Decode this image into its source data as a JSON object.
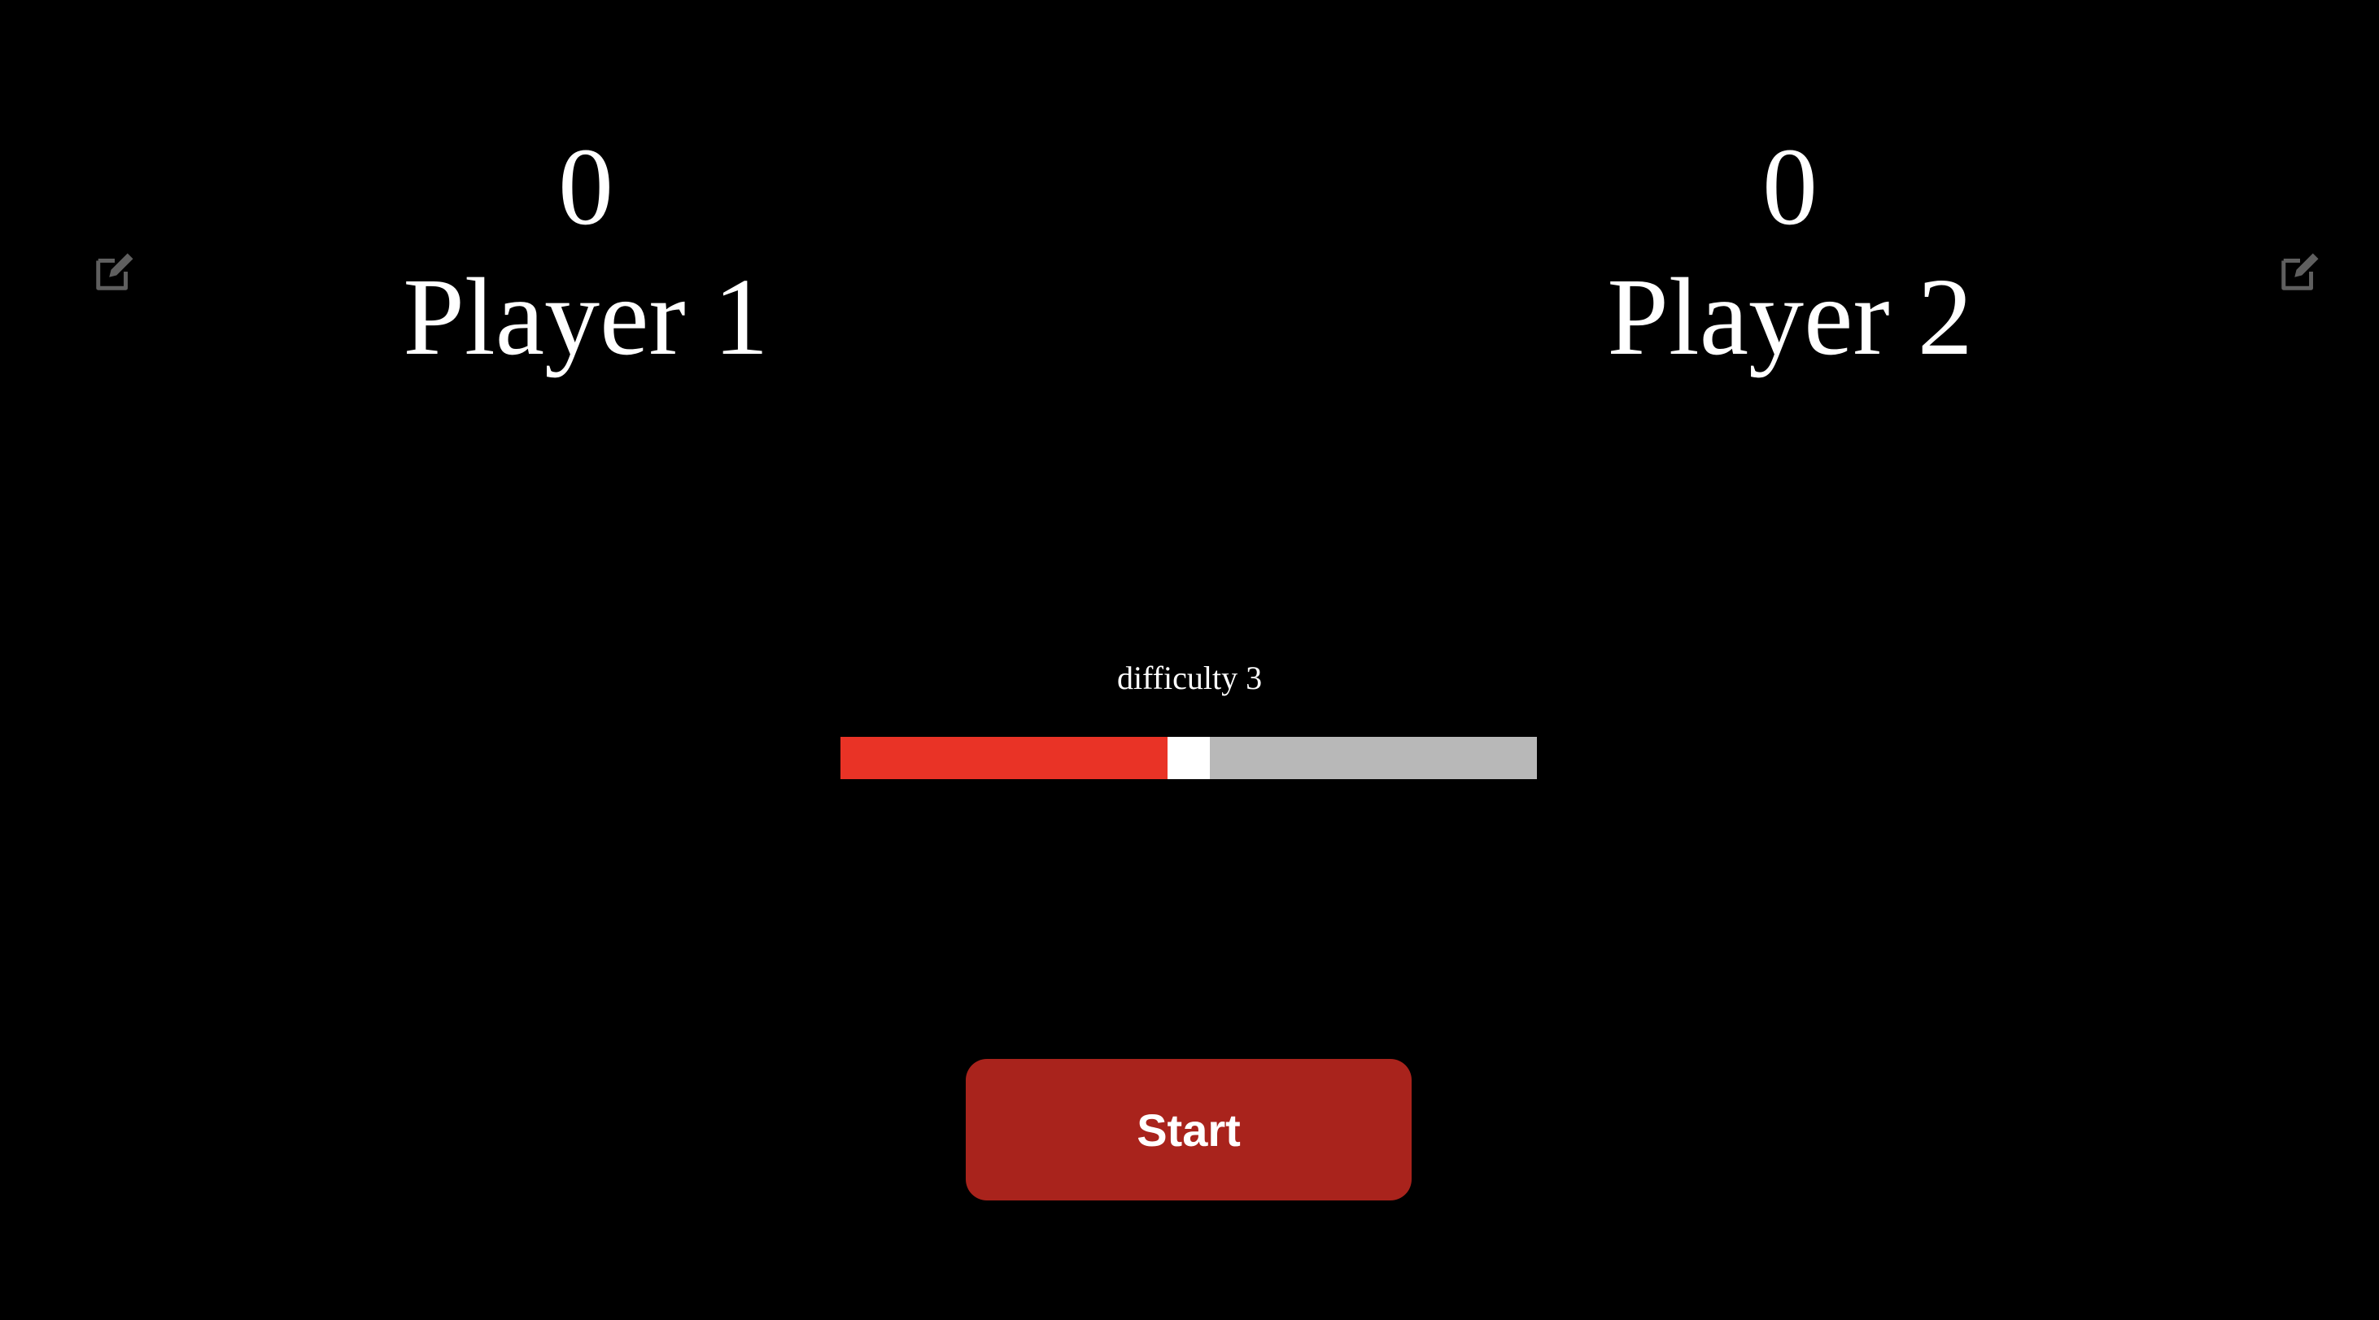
{
  "players": [
    {
      "score": "0",
      "name": "Player 1",
      "edit_icon": "edit-icon"
    },
    {
      "score": "0",
      "name": "Player 2",
      "edit_icon": "edit-icon"
    }
  ],
  "difficulty": {
    "label": "difficulty 3",
    "value": 3,
    "fraction": 0.5,
    "fill_color": "#e93326",
    "track_color": "#b8b8b8",
    "thumb_color": "#ffffff"
  },
  "start_button": {
    "label": "Start",
    "color": "#a9231c"
  },
  "colors": {
    "background": "#000000",
    "text": "#ffffff",
    "icon": "#5f5f5f"
  }
}
